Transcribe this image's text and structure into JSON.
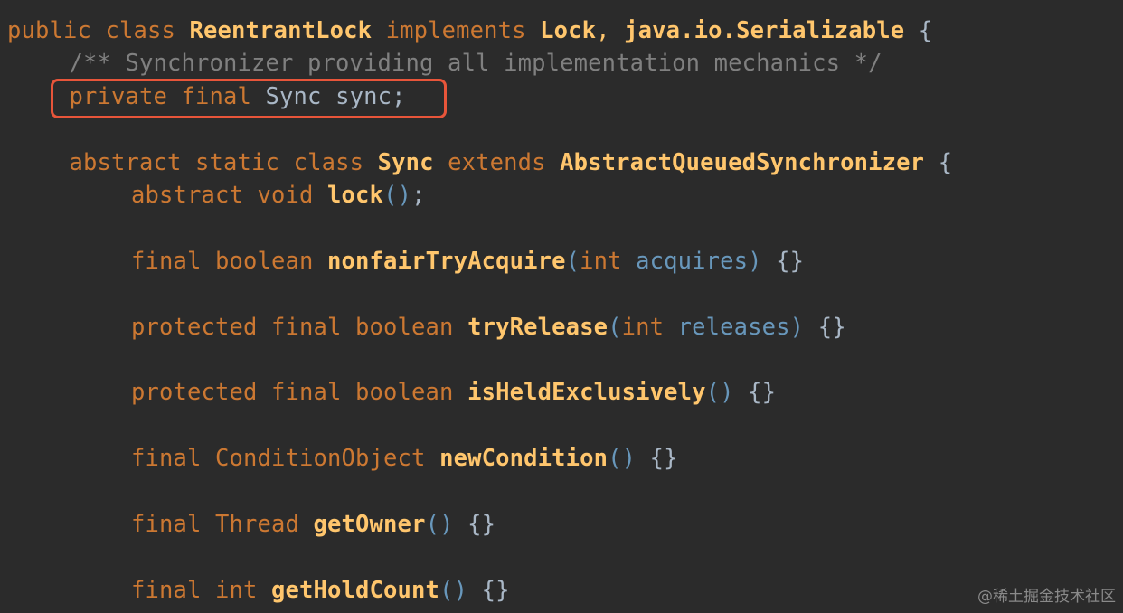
{
  "editor": {
    "theme": {
      "background": "#2b2b2b",
      "keyword": "#cc7832",
      "class_name": "#ffc66d",
      "comment": "#808080",
      "parameter": "#6897bb",
      "brace": "#a9b7c6",
      "highlight_border": "#e8553a"
    },
    "lines": [
      {
        "indent": 0,
        "tokens": [
          {
            "t": "public ",
            "k": "kw"
          },
          {
            "t": "class ",
            "k": "kw"
          },
          {
            "t": "ReentrantLock ",
            "k": "cls"
          },
          {
            "t": "implements ",
            "k": "kw"
          },
          {
            "t": "Lock",
            "k": "cls"
          },
          {
            "t": ", ",
            "k": "punc"
          },
          {
            "t": "java.io.Serializable ",
            "k": "cls"
          },
          {
            "t": "{",
            "k": "brace"
          }
        ]
      },
      {
        "indent": 1,
        "tokens": [
          {
            "t": "/** Synchronizer providing all implementation mechanics */",
            "k": "comment"
          }
        ]
      },
      {
        "indent": 1,
        "highlighted": true,
        "tokens": [
          {
            "t": "private ",
            "k": "kw"
          },
          {
            "t": "final ",
            "k": "kw"
          },
          {
            "t": "Sync ",
            "k": "sync"
          },
          {
            "t": "sync;",
            "k": "sync"
          }
        ]
      },
      {
        "indent": 0,
        "tokens": []
      },
      {
        "indent": 1,
        "tokens": [
          {
            "t": "abstract ",
            "k": "kw"
          },
          {
            "t": "static ",
            "k": "kw"
          },
          {
            "t": "class ",
            "k": "kw"
          },
          {
            "t": "Sync ",
            "k": "cls"
          },
          {
            "t": "extends ",
            "k": "kw"
          },
          {
            "t": "AbstractQueuedSynchronizer ",
            "k": "cls"
          },
          {
            "t": "{",
            "k": "brace"
          }
        ]
      },
      {
        "indent": 2,
        "tokens": [
          {
            "t": "abstract ",
            "k": "kw"
          },
          {
            "t": "void ",
            "k": "kw"
          },
          {
            "t": "lock",
            "k": "fn"
          },
          {
            "t": "()",
            "k": "paren"
          },
          {
            "t": ";",
            "k": "brace"
          }
        ]
      },
      {
        "indent": 0,
        "tokens": []
      },
      {
        "indent": 2,
        "tokens": [
          {
            "t": "final ",
            "k": "kw"
          },
          {
            "t": "boolean ",
            "k": "kw"
          },
          {
            "t": "nonfairTryAcquire",
            "k": "fn"
          },
          {
            "t": "(",
            "k": "paren"
          },
          {
            "t": "int ",
            "k": "kw"
          },
          {
            "t": "acquires",
            "k": "param"
          },
          {
            "t": ") ",
            "k": "paren"
          },
          {
            "t": "{}",
            "k": "brace"
          }
        ]
      },
      {
        "indent": 0,
        "tokens": []
      },
      {
        "indent": 2,
        "tokens": [
          {
            "t": "protected ",
            "k": "kw"
          },
          {
            "t": "final ",
            "k": "kw"
          },
          {
            "t": "boolean ",
            "k": "kw"
          },
          {
            "t": "tryRelease",
            "k": "fn"
          },
          {
            "t": "(",
            "k": "paren"
          },
          {
            "t": "int ",
            "k": "kw"
          },
          {
            "t": "releases",
            "k": "param"
          },
          {
            "t": ") ",
            "k": "paren"
          },
          {
            "t": "{}",
            "k": "brace"
          }
        ]
      },
      {
        "indent": 0,
        "tokens": []
      },
      {
        "indent": 2,
        "tokens": [
          {
            "t": "protected ",
            "k": "kw"
          },
          {
            "t": "final ",
            "k": "kw"
          },
          {
            "t": "boolean ",
            "k": "kw"
          },
          {
            "t": "isHeldExclusively",
            "k": "fn"
          },
          {
            "t": "() ",
            "k": "paren"
          },
          {
            "t": "{}",
            "k": "brace"
          }
        ]
      },
      {
        "indent": 0,
        "tokens": []
      },
      {
        "indent": 2,
        "tokens": [
          {
            "t": "final ",
            "k": "kw"
          },
          {
            "t": "ConditionObject ",
            "k": "kw"
          },
          {
            "t": "newCondition",
            "k": "fn"
          },
          {
            "t": "() ",
            "k": "paren"
          },
          {
            "t": "{}",
            "k": "brace"
          }
        ]
      },
      {
        "indent": 0,
        "tokens": []
      },
      {
        "indent": 2,
        "tokens": [
          {
            "t": "final ",
            "k": "kw"
          },
          {
            "t": "Thread ",
            "k": "kw"
          },
          {
            "t": "getOwner",
            "k": "fn"
          },
          {
            "t": "() ",
            "k": "paren"
          },
          {
            "t": "{}",
            "k": "brace"
          }
        ]
      },
      {
        "indent": 0,
        "tokens": []
      },
      {
        "indent": 2,
        "tokens": [
          {
            "t": "final ",
            "k": "kw"
          },
          {
            "t": "int ",
            "k": "kw"
          },
          {
            "t": "getHoldCount",
            "k": "fn"
          },
          {
            "t": "() ",
            "k": "paren"
          },
          {
            "t": "{}",
            "k": "brace"
          }
        ]
      }
    ]
  },
  "watermark": {
    "text": "@稀土掘金技术社区"
  }
}
